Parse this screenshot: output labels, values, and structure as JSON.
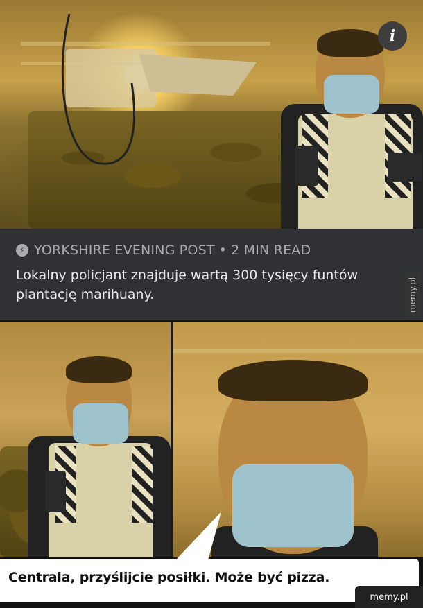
{
  "info_button": {
    "label": "i"
  },
  "article": {
    "source": "YORKSHIRE EVENING POST",
    "separator": "•",
    "read_time": "2 MIN READ",
    "headline": "Lokalny policjant znajduje wartą 300 tysięcy funtów plantację marihuany."
  },
  "meme": {
    "bubble_text": "Centrala, przyślijcie posiłki. Może być pizza."
  },
  "watermarks": {
    "side": "memy.pl",
    "bottom": "memy.pl"
  },
  "icons": {
    "info": "info-icon",
    "source": "bolt-icon"
  }
}
